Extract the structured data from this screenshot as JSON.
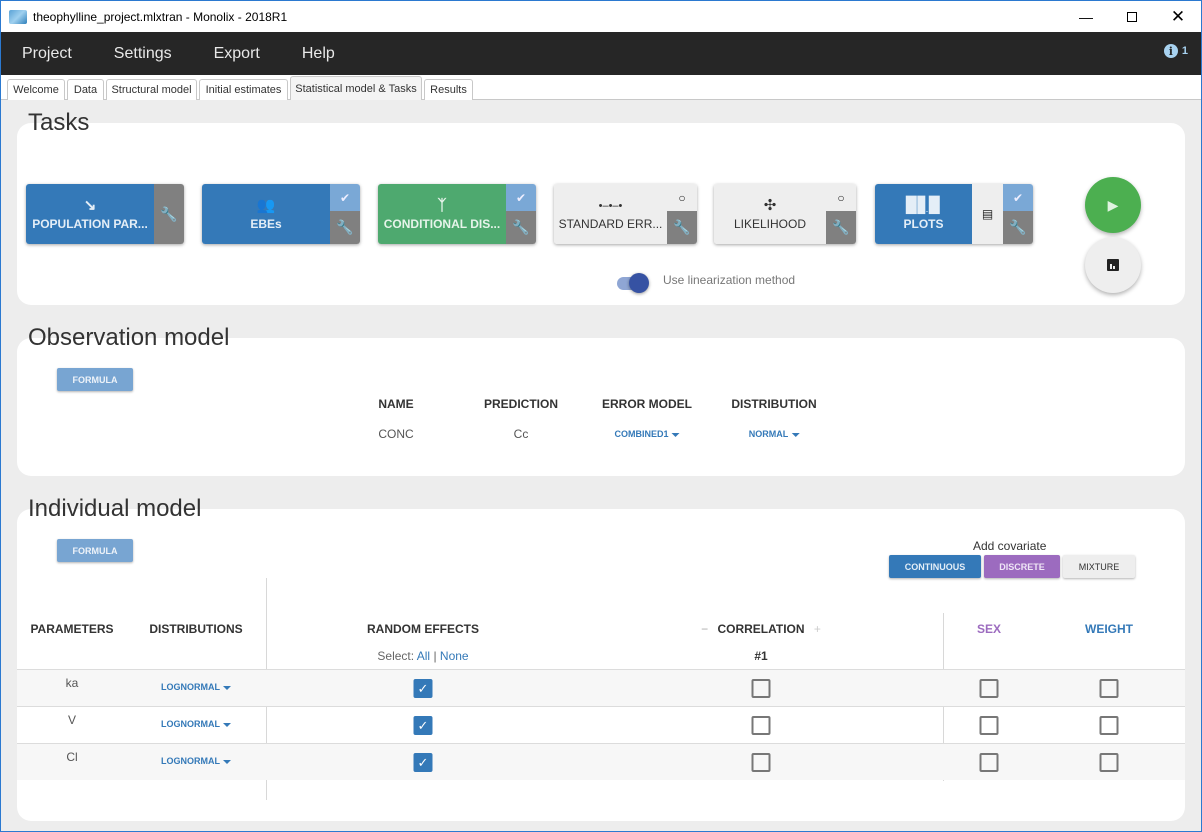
{
  "window": {
    "title": "theophylline_project.mlxtran - Monolix - 2018R1",
    "controls": [
      "minimize",
      "maximize",
      "close"
    ]
  },
  "menu": {
    "items": [
      "Project",
      "Settings",
      "Export",
      "Help"
    ],
    "info_count": "1"
  },
  "tabs": [
    {
      "label": "Welcome",
      "active": false
    },
    {
      "label": "Data",
      "active": false
    },
    {
      "label": "Structural model",
      "active": false
    },
    {
      "label": "Initial estimates",
      "active": false
    },
    {
      "label": "Statistical model & Tasks",
      "active": true
    },
    {
      "label": "Results",
      "active": false
    }
  ],
  "tasks": {
    "title": "Tasks",
    "cards": [
      {
        "label": "POPULATION PAR...",
        "icon": "trend-down-icon",
        "state": "active"
      },
      {
        "label": "EBEs",
        "icon": "people-icon",
        "state": "checked"
      },
      {
        "label": "CONDITIONAL DIS...",
        "icon": "branch-icon",
        "state": "checked"
      },
      {
        "label": "STANDARD ERR...",
        "icon": "dots-line-icon",
        "state": "unchecked"
      },
      {
        "label": "LIKELIHOOD",
        "icon": "move-icon",
        "state": "unchecked"
      },
      {
        "label": "PLOTS",
        "icon": "bar-chart-icon",
        "state": "checked"
      }
    ],
    "linearization_label": "Use linearization method",
    "linearization_on": true
  },
  "observation_model": {
    "title": "Observation model",
    "formula_label": "FORMULA",
    "headers": [
      "NAME",
      "PREDICTION",
      "ERROR MODEL",
      "DISTRIBUTION"
    ],
    "row": {
      "name": "CONC",
      "prediction": "Cc",
      "error_model": "COMBINED1",
      "distribution": "NORMAL"
    }
  },
  "individual_model": {
    "title": "Individual model",
    "formula_label": "FORMULA",
    "add_covariate_label": "Add covariate",
    "covariate_buttons": {
      "continuous": "CONTINUOUS",
      "discrete": "DISCRETE",
      "mixture": "MIXTURE"
    },
    "headers": {
      "parameters": "PARAMETERS",
      "distributions": "DISTRIBUTIONS",
      "random_effects": "RANDOM EFFECTS",
      "select_label": "Select:",
      "select_all": "All",
      "select_sep": "|",
      "select_none": "None",
      "correlation_minus": "−",
      "correlation": "CORRELATION",
      "correlation_plus": "+",
      "correlation_group": "#1",
      "sex": "SEX",
      "weight": "WEIGHT"
    },
    "rows": [
      {
        "parameter": "ka",
        "distribution": "LOGNORMAL",
        "random_effect": true,
        "correlation": false,
        "sex": false,
        "weight": false
      },
      {
        "parameter": "V",
        "distribution": "LOGNORMAL",
        "random_effect": true,
        "correlation": false,
        "sex": false,
        "weight": false
      },
      {
        "parameter": "Cl",
        "distribution": "LOGNORMAL",
        "random_effect": true,
        "correlation": false,
        "sex": false,
        "weight": false
      }
    ]
  },
  "colors": {
    "primary": "#3479b8",
    "success": "#4ea96f",
    "discrete": "#9c6bbf",
    "run": "#4caf50",
    "menubar": "#262626"
  }
}
